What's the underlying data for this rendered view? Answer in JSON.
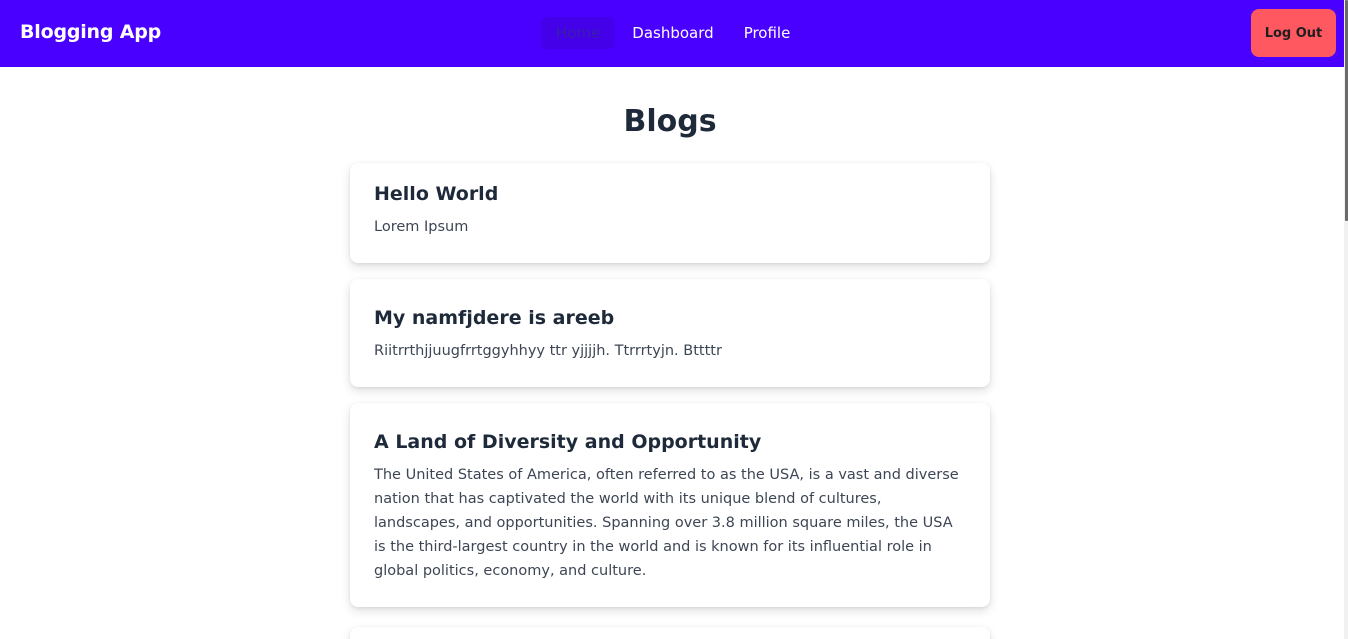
{
  "navbar": {
    "brand": "Blogging App",
    "links": [
      {
        "label": "Home",
        "active": true
      },
      {
        "label": "Dashboard",
        "active": false
      },
      {
        "label": "Profile",
        "active": false
      }
    ],
    "logout_label": "Log Out"
  },
  "main": {
    "title": "Blogs",
    "posts": [
      {
        "title": "Hello World",
        "body": "Lorem Ipsum"
      },
      {
        "title": "My namfjdere is areeb",
        "body": "Riitrrthjjuugfrrtggyhhyy ttr yjjjjh. Ttrrrtyjn. Bttttr"
      },
      {
        "title": "A Land of Diversity and Opportunity",
        "body": "The United States of America, often referred to as the USA, is a vast and diverse nation that has captivated the world with its unique blend of cultures, landscapes, and opportunities. Spanning over 3.8 million square miles, the USA is the third-largest country in the world and is known for its influential role in global politics, economy, and culture."
      }
    ]
  },
  "colors": {
    "navbar_bg": "#4a00ff",
    "logout_bg": "#ff5861",
    "title_text": "#1e2a3a",
    "body_text": "#3d4654"
  }
}
